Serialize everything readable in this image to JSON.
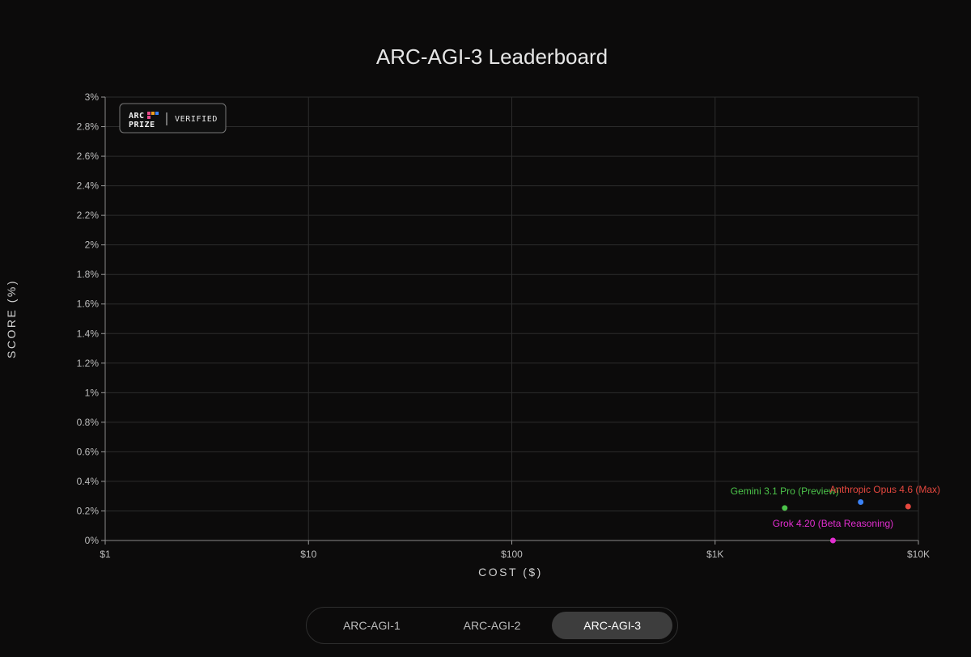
{
  "chart_data": {
    "type": "scatter",
    "title": "ARC-AGI-3 Leaderboard",
    "xlabel": "COST ($)",
    "ylabel": "SCORE (%)",
    "x_scale": "log",
    "xlim": [
      1,
      10000
    ],
    "ylim": [
      0,
      3
    ],
    "x_ticks": [
      {
        "value": 1,
        "label": "$1"
      },
      {
        "value": 10,
        "label": "$10"
      },
      {
        "value": 100,
        "label": "$100"
      },
      {
        "value": 1000,
        "label": "$1K"
      },
      {
        "value": 10000,
        "label": "$10K"
      }
    ],
    "y_ticks": [
      {
        "value": 0,
        "label": "0%"
      },
      {
        "value": 0.2,
        "label": "0.2%"
      },
      {
        "value": 0.4,
        "label": "0.4%"
      },
      {
        "value": 0.6,
        "label": "0.6%"
      },
      {
        "value": 0.8,
        "label": "0.8%"
      },
      {
        "value": 1.0,
        "label": "1%"
      },
      {
        "value": 1.2,
        "label": "1.2%"
      },
      {
        "value": 1.4,
        "label": "1.4%"
      },
      {
        "value": 1.6,
        "label": "1.6%"
      },
      {
        "value": 1.8,
        "label": "1.8%"
      },
      {
        "value": 2.0,
        "label": "2%"
      },
      {
        "value": 2.2,
        "label": "2.2%"
      },
      {
        "value": 2.4,
        "label": "2.4%"
      },
      {
        "value": 2.6,
        "label": "2.6%"
      },
      {
        "value": 2.8,
        "label": "2.8%"
      },
      {
        "value": 3.0,
        "label": "3%"
      }
    ],
    "grid": true,
    "points": [
      {
        "name": "Gemini 3.1 Pro (Preview)",
        "x": 2200,
        "y": 0.22,
        "color": "#4cc34a",
        "label": "Gemini 3.1 Pro (Preview)"
      },
      {
        "name": "Anthropic Opus 4.6",
        "x": 5200,
        "y": 0.26,
        "color": "#3b82f6",
        "label": ""
      },
      {
        "name": "Anthropic Opus 4.6 (Max)",
        "x": 8900,
        "y": 0.23,
        "color": "#e5473e",
        "label": "Anthropic Opus 4.6 (Max)"
      },
      {
        "name": "Grok 4.20 (Beta Reasoning)",
        "x": 3800,
        "y": 0.0,
        "color": "#e22ed0",
        "label": "Grok 4.20 (Beta Reasoning)"
      }
    ]
  },
  "badge": {
    "brand_line1": "ARC",
    "brand_line2": "PRIZE",
    "verified": "VERIFIED",
    "logo_colors": [
      "#e94a8c",
      "#f0a020",
      "#3b82f6",
      "#e94a8c"
    ]
  },
  "tabs": [
    {
      "label": "ARC-AGI-1",
      "active": false
    },
    {
      "label": "ARC-AGI-2",
      "active": false
    },
    {
      "label": "ARC-AGI-3",
      "active": true
    }
  ]
}
